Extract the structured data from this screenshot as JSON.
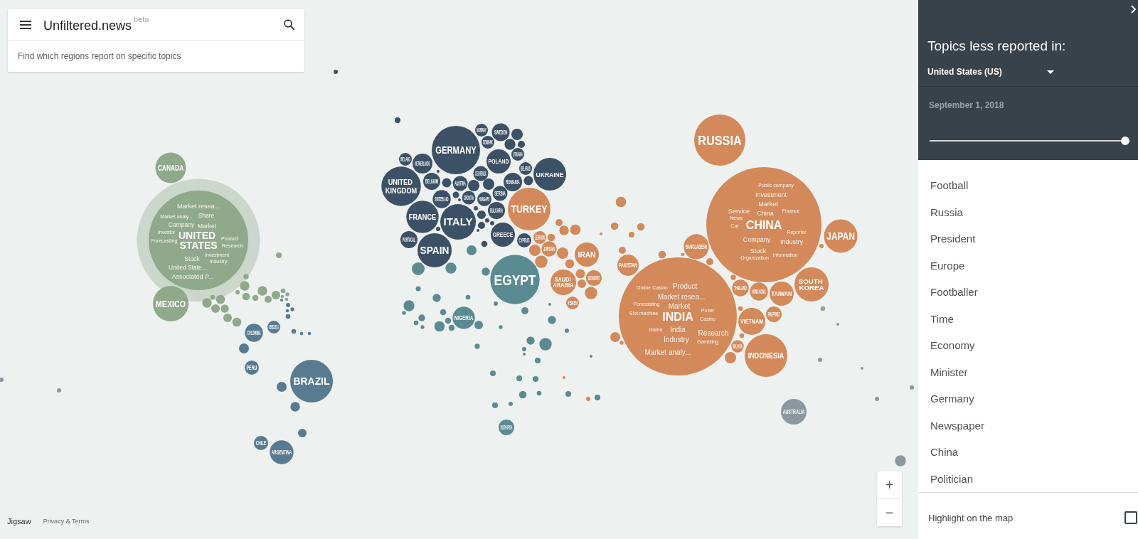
{
  "header": {
    "title": "Unfiltered.news",
    "badge": "beta",
    "subtitle": "Find which regions report on specific topics"
  },
  "map": {
    "regions": [
      {
        "color": "#8fa98a",
        "countries": [
          {
            "label": "CANADA",
            "selected": false
          },
          {
            "label": "UNITED STATES",
            "selected": true,
            "topics": [
              "Market resea...",
              "Market analy...",
              "Share",
              "Company",
              "Market",
              "Investor",
              "Forecasting",
              "Product",
              "Research",
              "Stock",
              "Investment",
              "Industry",
              "United State...",
              "Associated P..."
            ]
          },
          {
            "label": "MEXICO",
            "selected": false
          }
        ]
      },
      {
        "color": "#587b91",
        "countries": [
          {
            "label": "VENEZUELA",
            "selected": false
          },
          {
            "label": "COLOMBIA",
            "selected": false
          },
          {
            "label": "PERU",
            "selected": false
          },
          {
            "label": "BRAZIL",
            "selected": false
          },
          {
            "label": "CHILE",
            "selected": false
          },
          {
            "label": "ARGENTINA",
            "selected": false
          }
        ]
      },
      {
        "color": "#3c5165",
        "countries": [
          {
            "label": "NORWAY",
            "selected": false
          },
          {
            "label": "SWEDEN",
            "selected": false
          },
          {
            "label": "DENMARK",
            "selected": false
          },
          {
            "label": "GERMANY",
            "selected": false
          },
          {
            "label": "LITHUANIA",
            "selected": false
          },
          {
            "label": "IRELAND",
            "selected": false
          },
          {
            "label": "NETHERLANDS",
            "selected": false
          },
          {
            "label": "POLAND",
            "selected": false
          },
          {
            "label": "CZECH REPUBLIC",
            "selected": false
          },
          {
            "label": "BELARUS",
            "selected": false
          },
          {
            "label": "UKRAINE",
            "selected": false
          },
          {
            "label": "UNITED KINGDOM",
            "selected": false
          },
          {
            "label": "BELGIUM",
            "selected": false
          },
          {
            "label": "AUSTRIA",
            "selected": false
          },
          {
            "label": "ROMANIA",
            "selected": false
          },
          {
            "label": "SERBIA",
            "selected": false
          },
          {
            "label": "SWITZERLAND",
            "selected": false
          },
          {
            "label": "CROATIA",
            "selected": false
          },
          {
            "label": "HUNGARY",
            "selected": false
          },
          {
            "label": "BULGARIA",
            "selected": false
          },
          {
            "label": "FRANCE",
            "selected": false
          },
          {
            "label": "ITALY",
            "selected": false
          },
          {
            "label": "GREECE",
            "selected": false
          },
          {
            "label": "PORTUGAL",
            "selected": false
          },
          {
            "label": "CYPRUS",
            "selected": false
          },
          {
            "label": "SPAIN",
            "selected": false
          }
        ]
      },
      {
        "color": "#5b8b92",
        "countries": [
          {
            "label": "EGYPT",
            "selected": false
          },
          {
            "label": "NIGERIA",
            "selected": false
          },
          {
            "label": "SOUTH AFRICA",
            "selected": false
          }
        ]
      },
      {
        "color": "#d4895a",
        "countries": [
          {
            "label": "RUSSIA",
            "selected": false
          },
          {
            "label": "TURKEY",
            "selected": false
          },
          {
            "label": "LEBANON",
            "selected": false
          },
          {
            "label": "JORDAN",
            "selected": false
          },
          {
            "label": "BANGLADESH",
            "selected": false
          },
          {
            "label": "IRAN",
            "selected": false
          },
          {
            "label": "CHINA",
            "selected": false,
            "topics": [
              "Public company",
              "Investment",
              "Market",
              "Service",
              "China",
              "Finance",
              "News",
              "Car",
              "Reporter",
              "Company",
              "Industry",
              "Stock",
              "Organization",
              "Information"
            ]
          },
          {
            "label": "JAPAN",
            "selected": false
          },
          {
            "label": "PAKISTAN",
            "selected": false
          },
          {
            "label": "SAUDI ARABIA",
            "selected": false
          },
          {
            "label": "UNITED ARAB EMIRATES",
            "selected": false
          },
          {
            "label": "YEMEN",
            "selected": false
          },
          {
            "label": "INDIA",
            "selected": false,
            "topics": [
              "Online Casino",
              "Product",
              "Market resea...",
              "Forecasting",
              "Market",
              "Slot machine",
              "Poker",
              "Casino",
              "Game",
              "India",
              "Research",
              "Industry",
              "Gambling",
              "Market analy..."
            ]
          },
          {
            "label": "THAILAND",
            "selected": false
          },
          {
            "label": "HONG KONG",
            "selected": false
          },
          {
            "label": "TAIWAN",
            "selected": false
          },
          {
            "label": "SOUTH KOREA",
            "selected": false
          },
          {
            "label": "PHILIPPINES",
            "selected": false
          },
          {
            "label": "VIETNAM",
            "selected": false
          },
          {
            "label": "MALAYSIA",
            "selected": false
          },
          {
            "label": "INDONESIA",
            "selected": false
          }
        ]
      },
      {
        "color": "#8c97a1",
        "countries": [
          {
            "label": "AUSTRALIA",
            "selected": false
          }
        ]
      }
    ]
  },
  "zoom_controls": [
    "+",
    "−"
  ],
  "footer": {
    "brand": "Jigsaw",
    "link": "Privacy & Terms"
  },
  "panel": {
    "title": "Topics less reported in:",
    "country": "United States (US)",
    "date": "September 1, 2018",
    "date_slider": {
      "level": 1
    },
    "topics": [
      "Football",
      "Russia",
      "President",
      "Europe",
      "Footballer",
      "Time",
      "Economy",
      "Minister",
      "Germany",
      "Newspaper",
      "China",
      "Politician"
    ],
    "highlight": {
      "label": "Highlight on the map",
      "checked": false
    }
  }
}
